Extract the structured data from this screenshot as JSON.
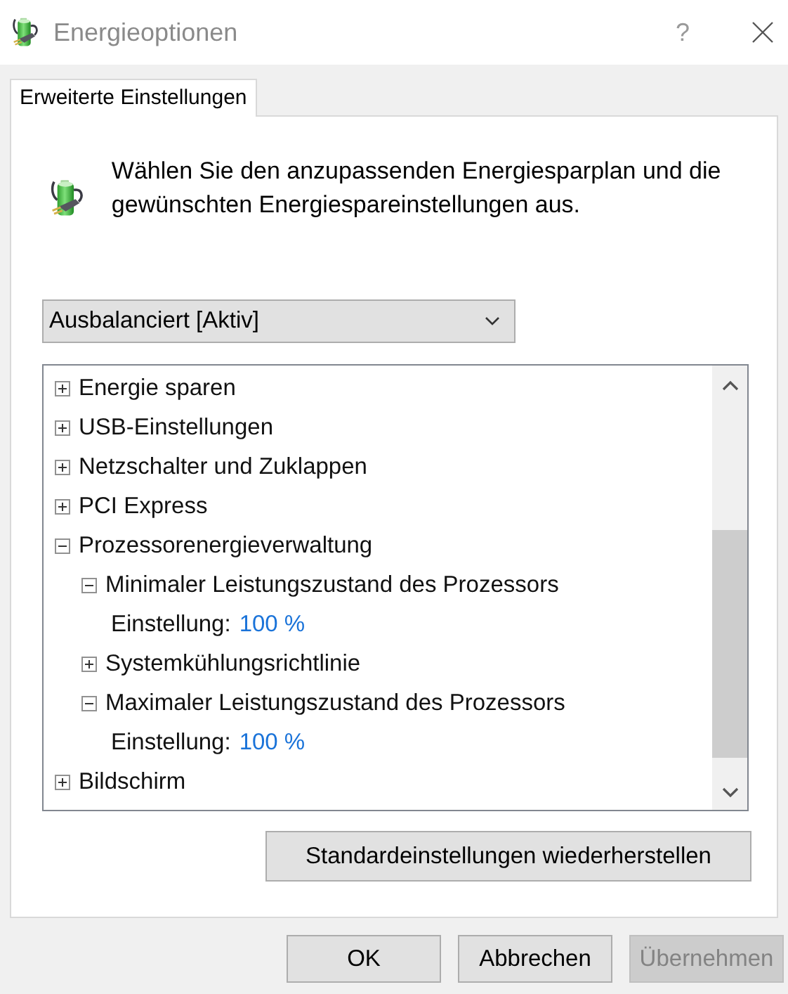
{
  "window": {
    "title": "Energieoptionen",
    "help": "?"
  },
  "tabs": [
    {
      "label": "Erweiterte Einstellungen",
      "selected": true
    }
  ],
  "intro": "Wählen Sie den anzupassenden Energiesparplan und die gewünschten Energiespareinstellungen aus.",
  "plan_dropdown": {
    "value": "Ausbalanciert [Aktiv]"
  },
  "tree": [
    {
      "kind": "group",
      "label": "Energie sparen",
      "expanded": false
    },
    {
      "kind": "group",
      "label": "USB-Einstellungen",
      "expanded": false
    },
    {
      "kind": "group",
      "label": "Netzschalter und Zuklappen",
      "expanded": false
    },
    {
      "kind": "group",
      "label": "PCI Express",
      "expanded": false
    },
    {
      "kind": "group",
      "label": "Prozessorenergieverwaltung",
      "expanded": true,
      "children": [
        {
          "kind": "group",
          "label": "Minimaler Leistungszustand des Prozessors",
          "expanded": true,
          "children": [
            {
              "kind": "setting",
              "label": "Einstellung:",
              "value": "100 %"
            }
          ]
        },
        {
          "kind": "group",
          "label": "Systemkühlungsrichtlinie",
          "expanded": false
        },
        {
          "kind": "group",
          "label": "Maximaler Leistungszustand des Prozessors",
          "expanded": true,
          "children": [
            {
              "kind": "setting",
              "label": "Einstellung:",
              "value": "100 %"
            }
          ]
        }
      ]
    },
    {
      "kind": "group",
      "label": "Bildschirm",
      "expanded": false
    }
  ],
  "restore_button": "Standardeinstellungen wiederherstellen",
  "buttons": [
    {
      "label": "OK",
      "disabled": false
    },
    {
      "label": "Abbrechen",
      "disabled": false
    },
    {
      "label": "Übernehmen",
      "disabled": true
    }
  ]
}
